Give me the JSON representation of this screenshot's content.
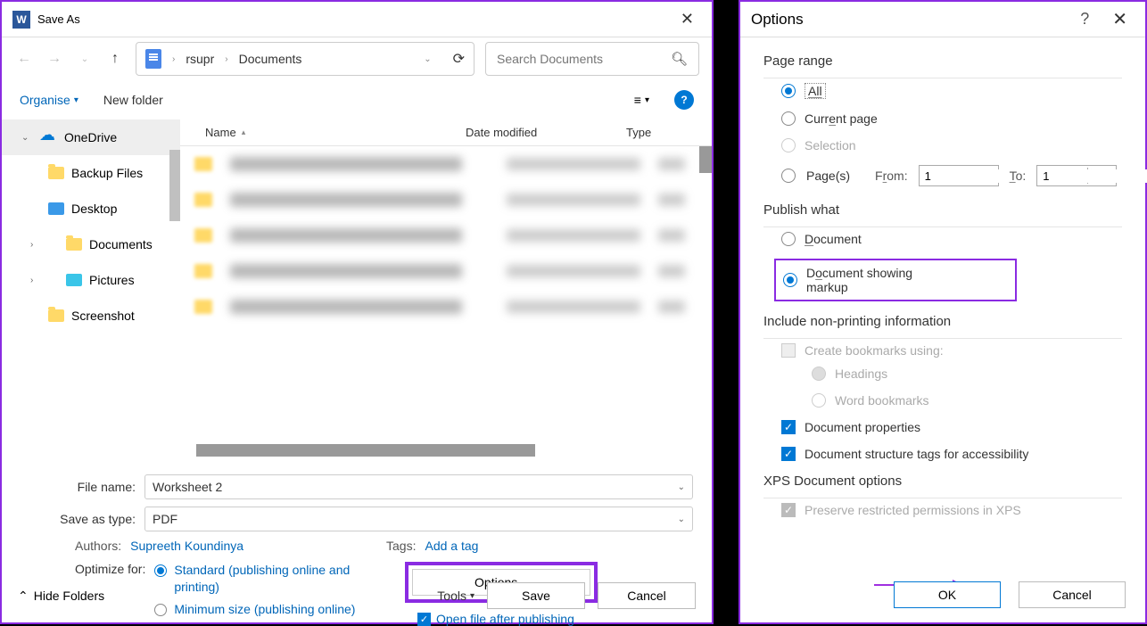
{
  "saveAs": {
    "title": "Save As",
    "breadcrumb": {
      "seg1": "rsupr",
      "seg2": "Documents"
    },
    "search": {
      "placeholder": "Search Documents"
    },
    "toolbar": {
      "organise": "Organise",
      "newFolder": "New folder"
    },
    "sidebar": {
      "items": [
        {
          "label": "OneDrive"
        },
        {
          "label": "Backup Files"
        },
        {
          "label": "Desktop"
        },
        {
          "label": "Documents"
        },
        {
          "label": "Pictures"
        },
        {
          "label": "Screenshot"
        }
      ]
    },
    "columns": {
      "name": "Name",
      "date": "Date modified",
      "type": "Type"
    },
    "fileName": {
      "label": "File name:",
      "value": "Worksheet 2"
    },
    "saveType": {
      "label": "Save as type:",
      "value": "PDF"
    },
    "authors": {
      "label": "Authors:",
      "value": "Supreeth Koundinya"
    },
    "tags": {
      "label": "Tags:",
      "value": "Add a tag"
    },
    "optimize": {
      "label": "Optimize for:",
      "standard": "Standard (publishing online and printing)",
      "minimum": "Minimum size (publishing online)"
    },
    "optionsButton": "Options...",
    "openAfter": "Open file after publishing",
    "footer": {
      "hide": "Hide Folders",
      "tools": "Tools",
      "save": "Save",
      "cancel": "Cancel"
    }
  },
  "options": {
    "title": "Options",
    "pageRange": {
      "title": "Page range",
      "all": "All",
      "current": "Current page",
      "selection": "Selection",
      "pages": "Page(s)",
      "from": "From:",
      "fromVal": "1",
      "to": "To:",
      "toVal": "1"
    },
    "publish": {
      "title": "Publish what",
      "document": "Document",
      "markup": "Document showing markup"
    },
    "nonprint": {
      "title": "Include non-printing information",
      "bookmarks": "Create bookmarks using:",
      "headings": "Headings",
      "wordbm": "Word bookmarks",
      "props": "Document properties",
      "tags": "Document structure tags for accessibility"
    },
    "xps": {
      "title": "XPS Document options",
      "preserve": "Preserve restricted permissions in XPS"
    },
    "buttons": {
      "ok": "OK",
      "cancel": "Cancel"
    }
  }
}
